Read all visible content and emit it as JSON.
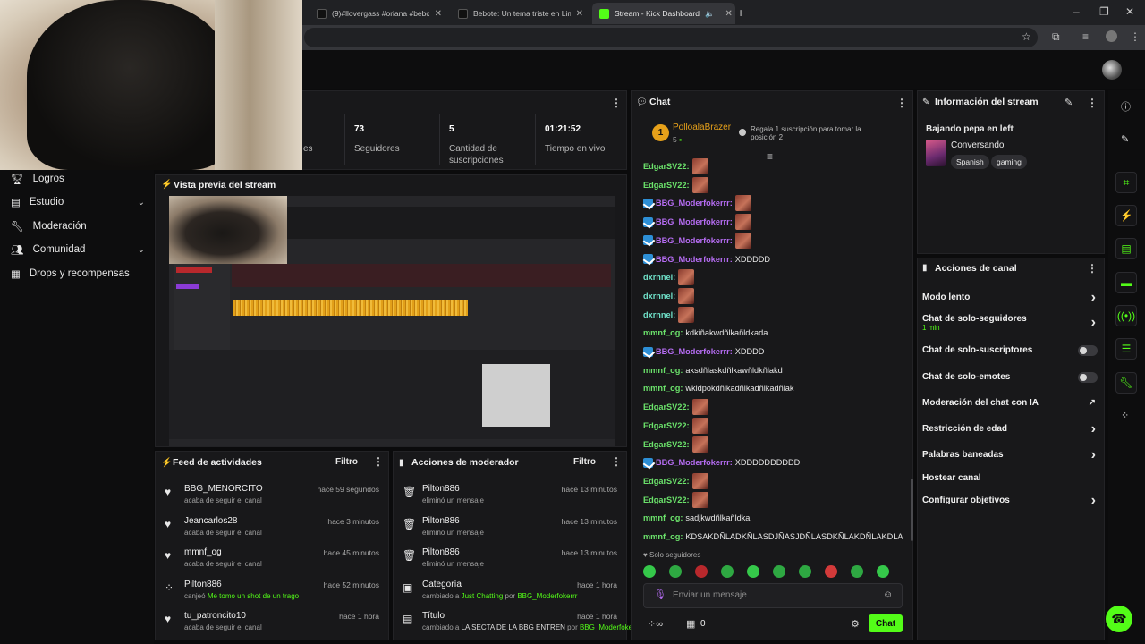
{
  "browser": {
    "tabs": [
      {
        "label": "(9)#llovergass #oriana #bebote"
      },
      {
        "label": "Bebote: Un tema triste en Lima"
      },
      {
        "label": "Stream - Kick Dashboard"
      }
    ]
  },
  "sidebar": {
    "items": [
      {
        "label": "Logros"
      },
      {
        "label": "Estudio"
      },
      {
        "label": "Moderación"
      },
      {
        "label": "Comunidad"
      },
      {
        "label": "Drops y recompensas"
      }
    ]
  },
  "stats": {
    "partial_label": "es",
    "items": [
      {
        "value": "73",
        "label": "Seguidores"
      },
      {
        "value": "5",
        "label": "Cantidad de suscripciones"
      },
      {
        "value": "01:21:52",
        "label": "Tiempo en vivo"
      }
    ]
  },
  "preview": {
    "title": "Vista previa del stream"
  },
  "activity_feed": {
    "title": "Feed de actividades",
    "filter_label": "Filtro",
    "rows": [
      {
        "name": "BBG_MENORCITO",
        "time": "hace 59 segundos",
        "sub": "acaba de seguir el canal",
        "icon": "heart-icon"
      },
      {
        "name": "Jeancarlos28",
        "time": "hace 3 minutos",
        "sub": "acaba de seguir el canal",
        "icon": "heart-icon"
      },
      {
        "name": "mmnf_og",
        "time": "hace 45 minutos",
        "sub": "acaba de seguir el canal",
        "icon": "heart-icon"
      },
      {
        "name": "Pilton886",
        "time": "hace 52 minutos",
        "sub_prefix": "canjeó",
        "sub_highlight": "Me tomo un shot de un trago",
        "icon": "points-icon"
      },
      {
        "name": "tu_patroncito10",
        "time": "hace 1 hora",
        "sub": "acaba de seguir el canal",
        "icon": "heart-icon"
      }
    ]
  },
  "mod_actions": {
    "title": "Acciones de moderador",
    "filter_label": "Filtro",
    "rows": [
      {
        "name": "Pilton886",
        "time": "hace 13 minutos",
        "sub": "eliminó un mensaje",
        "icon": "trash-icon"
      },
      {
        "name": "Pilton886",
        "time": "hace 13 minutos",
        "sub": "eliminó un mensaje",
        "icon": "trash-icon"
      },
      {
        "name": "Pilton886",
        "time": "hace 13 minutos",
        "sub": "eliminó un mensaje",
        "icon": "trash-icon"
      },
      {
        "name": "Categoría",
        "time": "hace 1 hora",
        "sub_prefix": "cambiado a",
        "sub_highlight": "Just Chatting",
        "sub_mid": "por",
        "sub_user": "BBG_Moderfokerrr",
        "icon": "category-icon"
      },
      {
        "name": "Título",
        "time": "hace 1 hora",
        "sub_prefix": "cambiado a",
        "sub_plain": "LA SECTA DE LA BBG ENTREN",
        "sub_mid": "por",
        "sub_user": "BBG_Moderfokerrr",
        "icon": "title-icon"
      }
    ]
  },
  "chat": {
    "title": "Chat",
    "pinned_user": "PolloalaBrazer",
    "pinned_rank": "1",
    "pinned_count": "5",
    "pinned_note": "Regala 1 suscripción para tomar la posición 2",
    "messages": [
      {
        "user": "EdgarSV22:",
        "text": "",
        "emote": true,
        "color": "green",
        "badge": false
      },
      {
        "user": "EdgarSV22:",
        "text": "",
        "emote": true,
        "color": "green",
        "badge": false
      },
      {
        "user": "BBG_Moderfokerrr:",
        "text": "",
        "emote": true,
        "color": "purple",
        "badge": true
      },
      {
        "user": "BBG_Moderfokerrr:",
        "text": "",
        "emote": true,
        "color": "purple",
        "badge": true
      },
      {
        "user": "BBG_Moderfokerrr:",
        "text": "",
        "emote": true,
        "color": "purple",
        "badge": true
      },
      {
        "user": "BBG_Moderfokerrr:",
        "text": "XDDDDD",
        "emote": false,
        "color": "purple",
        "badge": true
      },
      {
        "user": "dxrnnel:",
        "text": "",
        "emote": true,
        "color": "teal",
        "badge": false
      },
      {
        "user": "dxrnnel:",
        "text": "",
        "emote": true,
        "color": "teal",
        "badge": false
      },
      {
        "user": "dxrnnel:",
        "text": "",
        "emote": true,
        "color": "teal",
        "badge": false
      },
      {
        "user": "mmnf_og:",
        "text": "kdkiñakwdñlkañldkada",
        "emote": false,
        "color": "green",
        "badge": false
      },
      {
        "user": "BBG_Moderfokerrr:",
        "text": "XDDDD",
        "emote": false,
        "color": "purple",
        "badge": true
      },
      {
        "user": "mmnf_og:",
        "text": "aksdñlaskdñlkawñldkñlakd",
        "emote": false,
        "color": "green",
        "badge": false
      },
      {
        "user": "mmnf_og:",
        "text": "wkidpokdñlkadñlkadñlkadñlak",
        "emote": false,
        "color": "green",
        "badge": false
      },
      {
        "user": "EdgarSV22:",
        "text": "",
        "emote": true,
        "color": "green",
        "badge": false
      },
      {
        "user": "EdgarSV22:",
        "text": "",
        "emote": true,
        "color": "green",
        "badge": false
      },
      {
        "user": "EdgarSV22:",
        "text": "",
        "emote": true,
        "color": "green",
        "badge": false
      },
      {
        "user": "BBG_Moderfokerrr:",
        "text": "XDDDDDDDDDD",
        "emote": false,
        "color": "purple",
        "badge": true
      },
      {
        "user": "EdgarSV22:",
        "text": "",
        "emote": true,
        "color": "green",
        "badge": false
      },
      {
        "user": "EdgarSV22:",
        "text": "",
        "emote": true,
        "color": "green",
        "badge": false
      },
      {
        "user": "mmnf_og:",
        "text": "sadjkwdñlkañldka",
        "emote": false,
        "color": "green",
        "badge": false
      },
      {
        "user": "mmnf_og:",
        "text": "KDSAKDÑLADKÑLASDJÑASJDÑLASDKÑLAKDÑLAKDLA",
        "emote": false,
        "color": "green",
        "badge": false
      }
    ],
    "followers_only": "Solo seguidores",
    "input_placeholder": "Enviar un mensaje",
    "points_count": "0",
    "send_label": "Chat"
  },
  "stream_info": {
    "title": "Información del stream",
    "stream_title": "Bajando pepa en left",
    "category": "Conversando",
    "tags": [
      "Spanish",
      "gaming"
    ]
  },
  "channel_actions": {
    "title": "Acciones de canal",
    "items": [
      {
        "label": "Modo lento",
        "control": "chevron"
      },
      {
        "label": "Chat de solo-seguidores",
        "sub": "1 min",
        "control": "chevron"
      },
      {
        "label": "Chat de solo-suscriptores",
        "control": "toggle"
      },
      {
        "label": "Chat de solo-emotes",
        "control": "toggle"
      },
      {
        "label": "Moderación del chat con IA",
        "control": "external"
      },
      {
        "label": "Restricción de edad",
        "control": "chevron"
      },
      {
        "label": "Palabras baneadas",
        "control": "chevron"
      },
      {
        "label": "Hostear canal",
        "control": "none"
      },
      {
        "label": "Configurar objetivos",
        "control": "chevron"
      }
    ]
  },
  "colors": {
    "accent": "#53fc18",
    "panel": "#18181a",
    "background": "#0b0b0c"
  }
}
